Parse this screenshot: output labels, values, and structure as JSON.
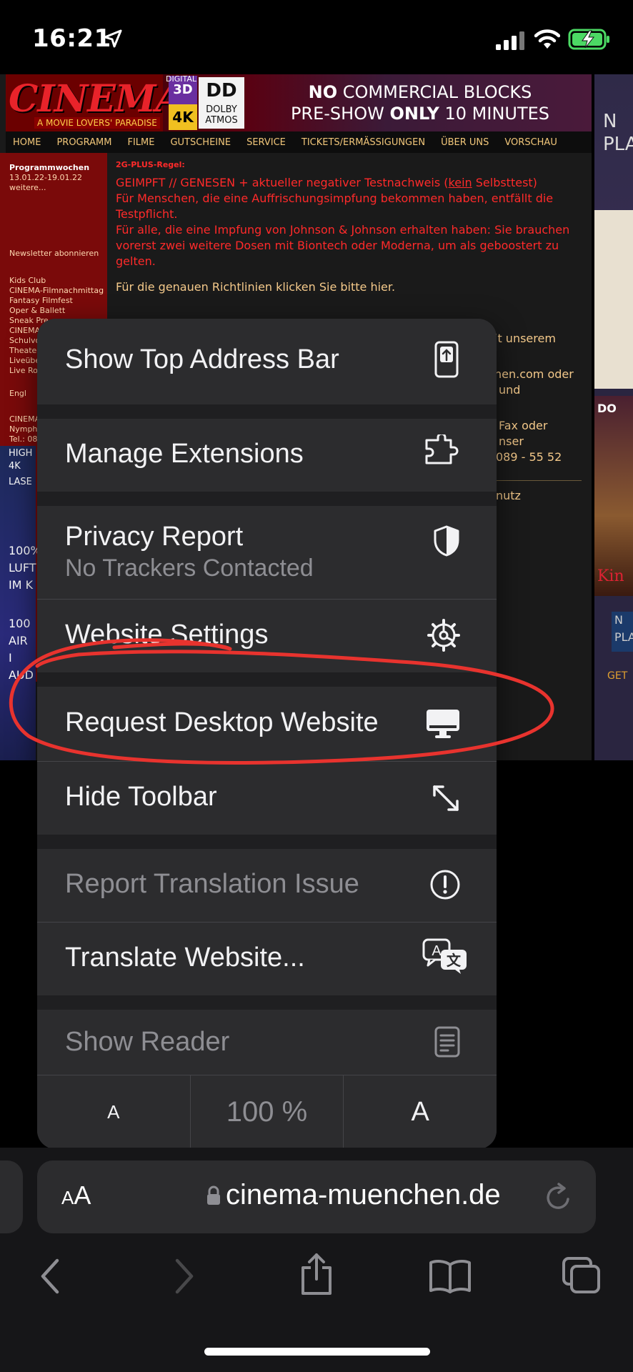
{
  "status_bar": {
    "time": "16:21"
  },
  "webpage": {
    "logo": {
      "name": "CINEMA",
      "tagline": "A MOVIE LOVERS' PARADISE"
    },
    "badges": {
      "digital": "DIGITAL",
      "three_d": "3D",
      "four_k": "4K",
      "dolby_mark": "DD",
      "dolby_line1": "DOLBY",
      "dolby_line2": "ATMOS"
    },
    "promo": {
      "line1_bold": "NO",
      "line1_rest": " COMMERCIAL BLOCKS",
      "line2_start": "PRE-SHOW ",
      "line2_bold": "ONLY",
      "line2_end": " 10 MINUTES"
    },
    "nav": [
      "HOME",
      "PROGRAMM",
      "FILME",
      "GUTSCHEINE",
      "SERVICE",
      "TICKETS/ERMÄSSIGUNGEN",
      "ÜBER UNS",
      "VORSCHAU"
    ],
    "sidebar": {
      "program_title": "Programmwochen",
      "program_dates": "13.01.22-19.01.22",
      "program_more": "weitere...",
      "newsletter": "Newsletter abonnieren",
      "links": [
        "Kids Club",
        "CINEMA-Filmnachmittag",
        "Fantasy Filmfest",
        "Oper & Ballett",
        "Sneak Pre",
        "CINEMA",
        "Schulvo",
        "Theater",
        "Liveübe",
        "Live Ro"
      ],
      "english": "Engl",
      "contact1": "CINEMA",
      "contact2": "Nymphe",
      "contact3": "Tel.: 089"
    },
    "content": {
      "rule_title": "2G-PLUS-Regel:",
      "red_line1_a": "GEIMPFT // GENESEN + aktueller negativer Testnachweis (",
      "red_line1_u": "kein",
      "red_line1_b": " Selbsttest)",
      "red_line2": "Für Menschen, die eine Auffrischungsimpfung bekommen haben, entfällt die Testpflicht.",
      "red_line3": "Für alle, die eine Impfung von Johnson & Johnson erhalten haben: Sie brauchen vorerst zwei weitere Dosen mit Biontech oder Moderna, um als geboostert zu gelten.",
      "gold_line": "Für die genauen Richtlinien klicken Sie bitte hier.",
      "frag1": "it unserem",
      "frag2": "nen.com oder",
      "frag3": "und",
      "frag4": "Fax oder",
      "frag5": "nser",
      "frag6": "089 - 55 52",
      "frag7": "nutz"
    },
    "right_peek": {
      "line1": "N",
      "line2": "PLA",
      "dd": "DO",
      "kin": "Kin",
      "box": "N PLA",
      "get": "GET"
    },
    "left_peek": [
      "100%",
      "LUFT",
      "IM K",
      "100",
      "AIR",
      "I",
      "AUD"
    ],
    "left_peek_small": [
      "HIGH",
      "4K LASE"
    ]
  },
  "menu": {
    "items": [
      {
        "label": "Show Top Address Bar",
        "icon": "phone-top-bar-icon"
      },
      {
        "label": "Manage Extensions",
        "icon": "puzzle-extension-icon"
      },
      {
        "label": "Privacy Report",
        "sublabel": "No Trackers Contacted",
        "icon": "shield-icon"
      },
      {
        "label": "Website Settings",
        "icon": "gear-icon"
      },
      {
        "label": "Request Desktop Website",
        "icon": "desktop-monitor-icon"
      },
      {
        "label": "Hide Toolbar",
        "icon": "expand-arrows-icon"
      },
      {
        "label": "Report Translation Issue",
        "icon": "exclamation-circle-icon"
      },
      {
        "label": "Translate Website...",
        "icon": "translate-icon"
      },
      {
        "label": "Show Reader",
        "icon": "reader-page-icon"
      }
    ],
    "zoom": {
      "decrease": "A",
      "level": "100 %",
      "increase": "A"
    }
  },
  "toolbar": {
    "aa_small": "A",
    "aa_large": "A",
    "url": "cinema-muenchen.de"
  },
  "colors": {
    "annotation": "#e8332e",
    "menu_bg": "#2c2c2e",
    "accent_red": "#ff2a2a",
    "battery": "#4cd964"
  }
}
